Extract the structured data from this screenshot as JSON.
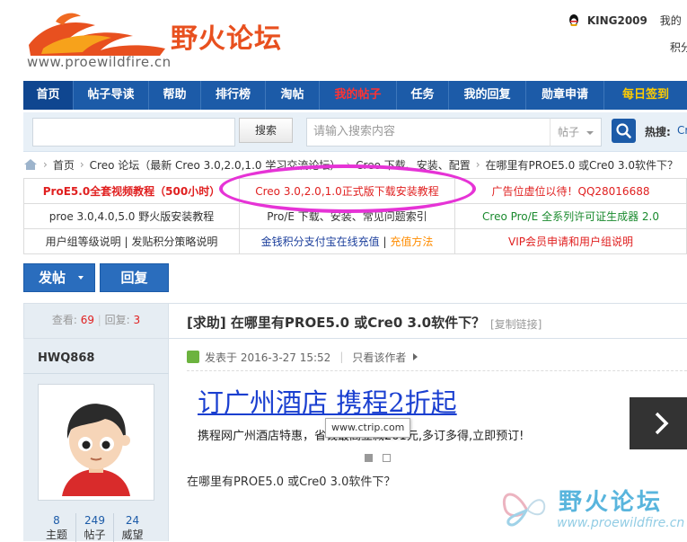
{
  "header": {
    "logo_text": "野火论坛",
    "logo_url": "www.proewildfire.cn",
    "username": "KING2009",
    "my_menu": "我的",
    "points_label": "积分"
  },
  "nav": {
    "items": [
      {
        "label": "首页"
      },
      {
        "label": "帖子导读"
      },
      {
        "label": "帮助"
      },
      {
        "label": "排行榜"
      },
      {
        "label": "淘帖"
      },
      {
        "label": "我的帖子"
      },
      {
        "label": "任务"
      },
      {
        "label": "我的回复"
      },
      {
        "label": "勋章申请"
      },
      {
        "label": "每日签到"
      }
    ]
  },
  "search": {
    "button": "搜索",
    "placeholder": "请输入搜索内容",
    "type": "帖子",
    "hot_label": "热搜:",
    "hot_item": "Cr"
  },
  "breadcrumb": {
    "home": "首页",
    "forum": "Creo 论坛（最新 Creo 3.0,2.0,1.0 学习交流论坛）",
    "subforum": "Creo 下载、安装、配置",
    "thread": "在哪里有PROE5.0 或Cre0 3.0软件下？"
  },
  "ads": {
    "rows": [
      [
        "ProE5.0全套视频教程（500小时）",
        "Creo 3.0,2.0,1.0正式版下载安装教程",
        "广告位虚位以待！QQ28016688"
      ],
      [
        "proe 3.0,4.0,5.0 野火版安装教程",
        "Pro/E 下载、安装、常见问题索引",
        "Creo Pro/E 全系列许可证生成器 2.0"
      ],
      [
        "用户组等级说明 | 发贴积分策略说明",
        "金钱积分支付宝在线充值",
        "VIP会员申请和用户组说明"
      ]
    ],
    "recharge": "充值方法",
    "divider": "|"
  },
  "actions": {
    "post": "发帖",
    "reply": "回复"
  },
  "thread": {
    "views_label": "查看:",
    "views": "69",
    "sep": "|",
    "replies_label": "回复:",
    "replies": "3",
    "title": "[求助] 在哪里有PROE5.0 或Cre0 3.0软件下？",
    "copy_link": "[复制链接]",
    "author": "HWQ868",
    "posted_label": "发表于 2016-3-27 15:52",
    "only_author": "只看该作者",
    "body": "在哪里有PROE5.0 或Cre0 3.0软件下？",
    "user_stats": [
      {
        "value": "8",
        "label": "主题"
      },
      {
        "value": "249",
        "label": "帖子"
      },
      {
        "value": "24",
        "label": "威望"
      }
    ]
  },
  "ad_banner": {
    "title": "订广州酒店 携程2折起",
    "desc": "携程网广州酒店特惠，省钱最高立减201元,多订多得,立即预订!",
    "tooltip": "www.ctrip.com"
  },
  "watermark": {
    "cn": "野火论坛",
    "url": "www.proewildfire.cn"
  },
  "colors": {
    "nav_bg": "#1c5ba8",
    "accent_red": "#e02020",
    "highlight_circle": "#e633d6"
  }
}
